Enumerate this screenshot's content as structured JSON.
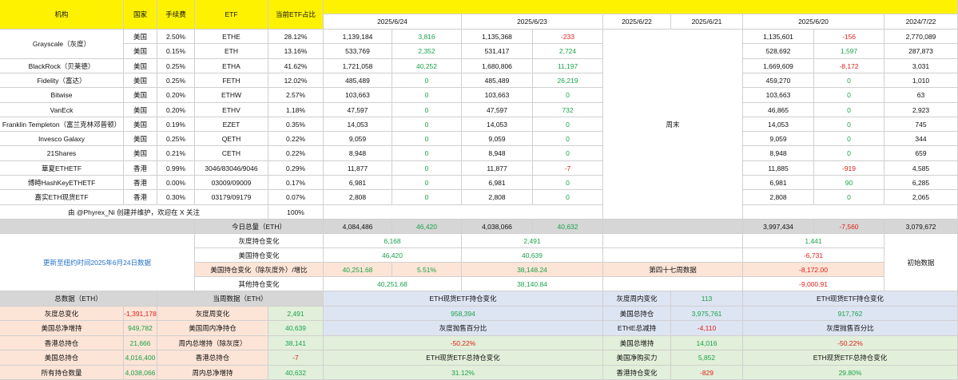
{
  "header": {
    "institution": "机构",
    "country": "国家",
    "fee": "手续费",
    "etf": "ETF",
    "share": "当前ETF占比",
    "dates": [
      "2025/6/24",
      "2025/6/23",
      "2025/6/22",
      "2025/6/21",
      "2025/6/20",
      "2024/7/22"
    ]
  },
  "rows": [
    {
      "name": "Grayscale（灰度）",
      "country": "美国",
      "fee": "2.50%",
      "etf": "ETHE",
      "share": "28.12%",
      "d24": "1,139,184",
      "c24": "3,816",
      "d23": "1,135,368",
      "c23": "-233",
      "d20": "1,135,601",
      "c20": "-156",
      "d0722": "2,770,089"
    },
    {
      "name": "",
      "country": "美国",
      "fee": "0.15%",
      "etf": "ETH",
      "share": "13.16%",
      "d24": "533,769",
      "c24": "2,352",
      "d23": "531,417",
      "c23": "2,724",
      "d20": "528,692",
      "c20": "1,597",
      "d0722": "287,873"
    },
    {
      "name": "BlackRock（贝莱德）",
      "country": "美国",
      "fee": "0.25%",
      "etf": "ETHA",
      "share": "41.62%",
      "d24": "1,721,058",
      "c24": "40,252",
      "d23": "1,680,806",
      "c23": "11,197",
      "d20": "1,669,609",
      "c20": "-8,172",
      "d0722": "3,031"
    },
    {
      "name": "Fidelity（富达）",
      "country": "美国",
      "fee": "0.25%",
      "etf": "FETH",
      "share": "12.02%",
      "d24": "485,489",
      "c24": "0",
      "d23": "485,489",
      "c23": "26,219",
      "d20": "459,270",
      "c20": "0",
      "d0722": "1,010"
    },
    {
      "name": "Bitwise",
      "country": "美国",
      "fee": "0.20%",
      "etf": "ETHW",
      "share": "2.57%",
      "d24": "103,663",
      "c24": "0",
      "d23": "103,663",
      "c23": "0",
      "d20": "103,663",
      "c20": "0",
      "d0722": "63"
    },
    {
      "name": "VanEck",
      "country": "美国",
      "fee": "0.20%",
      "etf": "ETHV",
      "share": "1.18%",
      "d24": "47,597",
      "c24": "0",
      "d23": "47,597",
      "c23": "732",
      "d20": "46,865",
      "c20": "0",
      "d0722": "2,923"
    },
    {
      "name": "Franklin Templeton（富兰克林邓普顿）",
      "country": "美国",
      "fee": "0.19%",
      "etf": "EZET",
      "share": "0.35%",
      "d24": "14,053",
      "c24": "0",
      "d23": "14,053",
      "c23": "0",
      "d20": "14,053",
      "c20": "0",
      "d0722": "745"
    },
    {
      "name": "Invesco Galaxy",
      "country": "美国",
      "fee": "0.25%",
      "etf": "QETH",
      "share": "0.22%",
      "d24": "9,059",
      "c24": "0",
      "d23": "9,059",
      "c23": "0",
      "d20": "9,059",
      "c20": "0",
      "d0722": "344"
    },
    {
      "name": "21Shares",
      "country": "美国",
      "fee": "0.21%",
      "etf": "CETH",
      "share": "0.22%",
      "d24": "8,948",
      "c24": "0",
      "d23": "8,948",
      "c23": "0",
      "d20": "8,948",
      "c20": "0",
      "d0722": "659"
    },
    {
      "name": "華夏ETHETF",
      "country": "香港",
      "fee": "0.99%",
      "etf": "3046/83046/9046",
      "share": "0.29%",
      "d24": "11,877",
      "c24": "0",
      "d23": "11,877",
      "c23": "-7",
      "d20": "11,885",
      "c20": "-919",
      "d0722": "4,585"
    },
    {
      "name": "博時HashKeyETHETF",
      "country": "香港",
      "fee": "0.00%",
      "etf": "03009/09009",
      "share": "0.17%",
      "d24": "6,981",
      "c24": "0",
      "d23": "6,981",
      "c23": "0",
      "d20": "6,981",
      "c20": "90",
      "d0722": "6,285"
    },
    {
      "name": "嘉实ETH现货ETF",
      "country": "香港",
      "fee": "0.30%",
      "etf": "03179/09179",
      "share": "0.07%",
      "d24": "2,808",
      "c24": "0",
      "d23": "2,808",
      "c23": "0",
      "d20": "2,808",
      "c20": "0",
      "d0722": "2,065"
    }
  ],
  "weekend_label": "周末",
  "credit": "由 @Phyrex_Ni 创建并维护，欢迎在 X 关注",
  "credit_pct": "100%",
  "total": {
    "label": "今日总量（ETH）",
    "d24": "4,084,486",
    "c24": "46,420",
    "d23": "4,038,066",
    "c23": "40,632",
    "d20": "3,997,434",
    "c20": "-7,560",
    "d0722": "3,079,672"
  },
  "update_note": "更新至纽约时间2025年6月24日数据",
  "changes": {
    "grayscale_label": "灰度持仓变化",
    "grayscale_24": "6,168",
    "grayscale_23": "2,491",
    "grayscale_20": "1,441",
    "us_label": "美国持仓变化",
    "us_24": "46,420",
    "us_23": "40,639",
    "us_20": "-6,731",
    "usx_label": "美国持仓变化（除灰度外）/增比",
    "usx_24": "40,251.68",
    "usx_24p": "5.51%",
    "usx_23": "38,148.24",
    "week_label": "第四十七周数据",
    "usx_20": "-8,172.00",
    "other_label": "其他持仓变化",
    "other_24": "40,251.68",
    "other_23": "38,140.84",
    "other_20": "-9,000.91",
    "initial_label": "初始数据"
  },
  "summary": {
    "total_header": "总数据（ETH）",
    "week_header": "当周数据（ETH）",
    "left": [
      {
        "label": "灰度总变化",
        "value": "-1,391,178"
      },
      {
        "label": "美国总净增持",
        "value": "949,782"
      },
      {
        "label": "香港总持仓",
        "value": "21,666"
      },
      {
        "label": "美国总持仓",
        "value": "4,016,400"
      },
      {
        "label": "所有持仓数量",
        "value": "4,038,066"
      }
    ],
    "week": [
      {
        "label": "灰度周变化",
        "value": "2,491"
      },
      {
        "label": "美国周内净持仓",
        "value": "40,639"
      },
      {
        "label": "周内总增持（除灰度）",
        "value": "38,141"
      },
      {
        "label": "香港总持仓",
        "value": "-7"
      },
      {
        "label": "周内总净增持",
        "value": "40,632"
      }
    ],
    "mid": [
      {
        "label": "ETH现货ETF持仓变化",
        "value": "958,394"
      },
      {
        "label": "灰度抛售百分比",
        "value": "-50.22%"
      },
      {
        "label": "ETH现货ETF总持仓变化",
        "value": "31.12%"
      }
    ],
    "right": [
      {
        "label": "灰度周内变化",
        "value": "113"
      },
      {
        "label": "美国总持仓",
        "value": "3,975,761"
      },
      {
        "label": "ETHE总减持",
        "value": "-4,110"
      },
      {
        "label": "美国总增持",
        "value": "14,016"
      },
      {
        "label": "美国净购买力",
        "value": "5,852"
      },
      {
        "label": "香港持仓变化",
        "value": "-829"
      }
    ],
    "far": [
      {
        "label": "ETH现货ETF持仓变化",
        "value": "917,762"
      },
      {
        "label": "灰度抛售百分比",
        "value": "-50.22%"
      },
      {
        "label": "ETH现货ETF总持仓变化",
        "value": "29.80%"
      }
    ]
  }
}
